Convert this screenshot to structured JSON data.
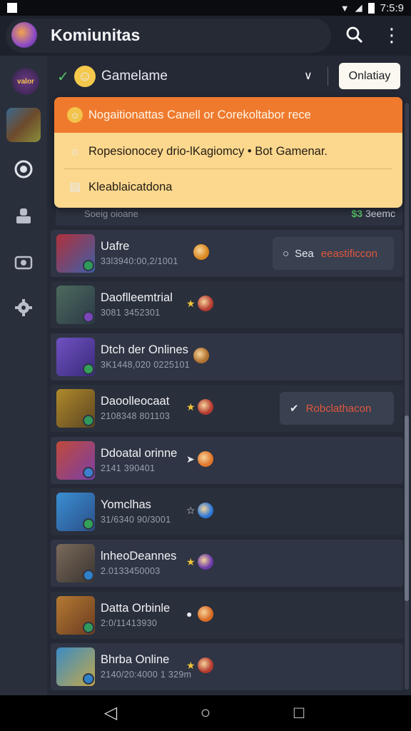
{
  "status_bar": {
    "time": "7:5:9"
  },
  "app_bar": {
    "title": "Komiunitas",
    "search_icon": "search-icon",
    "more_icon": "more-vert-icon"
  },
  "rail": {
    "logo_text": "valor",
    "items": [
      "avatar-thumb",
      "circle-icon",
      "person-icon",
      "camera-icon",
      "settings-icon"
    ]
  },
  "filter": {
    "label": "Gamelame",
    "button": "Onlatiay"
  },
  "dropdown": {
    "header": "Nogaitionattas Canell or Corekoltabor rece",
    "item1": "Ropesionocey drio-lKagiomcy  • Bot Gamenar.",
    "item2": "Kleablaicatdona"
  },
  "peek_row": {
    "left": "Soeig oioane",
    "right_prefix": "$3",
    "right": "3eemc"
  },
  "players": [
    {
      "name": "Uafre",
      "sub": "33l3940:00,2/1001",
      "action_icon": "○",
      "action_label": "Sea",
      "action_tag": "eeastificcon",
      "colors": [
        "#b1303b",
        "#3c5fa7"
      ],
      "badge": "#2f9a5b",
      "mark": "",
      "glyph": "#d9891f"
    },
    {
      "name": "Daoflleemtrial",
      "sub": "3081 3452301",
      "mark": "★",
      "glyph": "#b53a2f",
      "colors": [
        "#4c6a5d",
        "#2c3a46"
      ],
      "badge": "#7a46b8"
    },
    {
      "name": "Dtch der Onlines",
      "sub": "3K1448,020 0225101",
      "mark": "",
      "glyph": "#b0702f",
      "colors": [
        "#6f51c2",
        "#3a2b79"
      ],
      "badge": "#34a05a"
    },
    {
      "name": "Daoolleocaat",
      "sub": "2108348 801103",
      "mark": "★",
      "glyph": "#b53a2f",
      "action_icon": "✔",
      "action_label": "",
      "action_tag": "Robclathacon",
      "colors": [
        "#b08a2c",
        "#5b4520"
      ],
      "badge": "#2f9a5b"
    },
    {
      "name": "Ddoatal orinne",
      "sub": "2141 390401",
      "mark": "➤",
      "glyph": "#e0752b",
      "colors": [
        "#c04a3a",
        "#7b3fa6"
      ],
      "badge": "#3f7fd0"
    },
    {
      "name": "Yomclhas",
      "sub": "31/6340 90/3001",
      "mark": "☆",
      "glyph": "#2b76d6",
      "colors": [
        "#3a8fd3",
        "#2b4f88"
      ],
      "badge": "#34a05a"
    },
    {
      "name": "lnheoDeannes",
      "sub": "2.0133450003",
      "mark": "★",
      "glyph": "#6b3aaa",
      "colors": [
        "#7a6a5b",
        "#3a3430"
      ],
      "badge": "#2f80c8"
    },
    {
      "name": "Datta Orbinle",
      "sub": "2:0/11413930",
      "mark": "●",
      "glyph": "#d96a24",
      "colors": [
        "#b57a34",
        "#6a3b1f"
      ],
      "badge": "#2f9a5b"
    },
    {
      "name": "Bhrba Online",
      "sub": "2140/20:4000 1 329m",
      "mark": "★",
      "glyph": "#b53a2f",
      "colors": [
        "#3b8bc4",
        "#c2a84a"
      ],
      "badge": "#2f80c8"
    }
  ]
}
